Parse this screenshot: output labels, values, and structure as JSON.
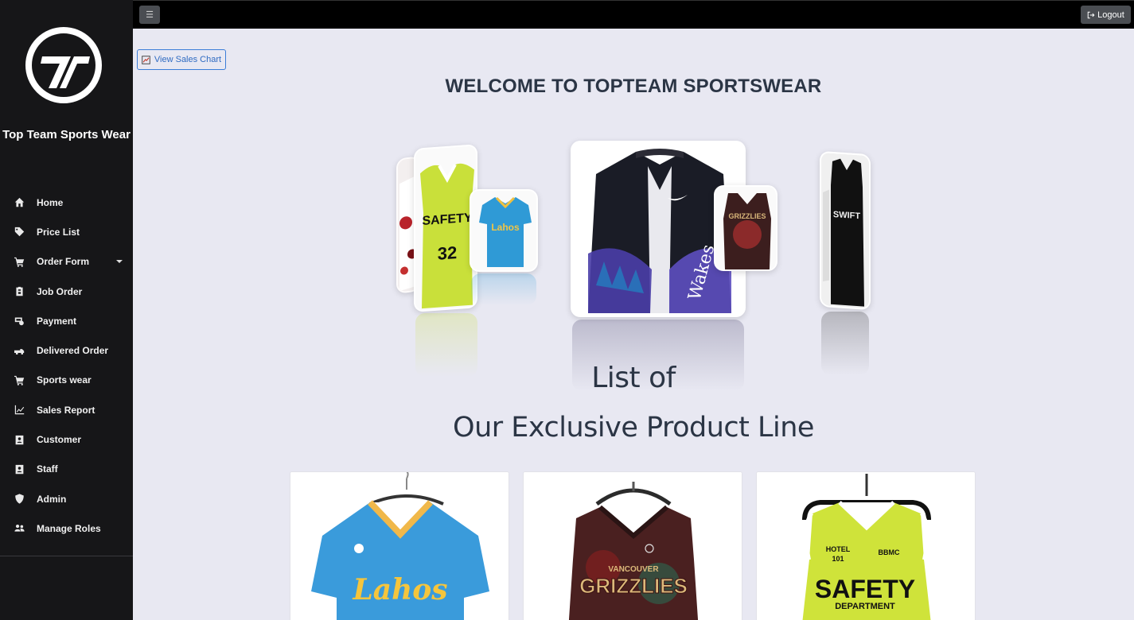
{
  "sidebar": {
    "brand": "Top Team Sports Wear",
    "items": [
      {
        "label": "Home",
        "icon": "home-icon"
      },
      {
        "label": "Price List",
        "icon": "tag-icon"
      },
      {
        "label": "Order Form",
        "icon": "cart-icon",
        "has_dropdown": true
      },
      {
        "label": "Job Order",
        "icon": "clipboard-icon"
      },
      {
        "label": "Payment",
        "icon": "money-icon"
      },
      {
        "label": "Delivered Order",
        "icon": "truck-icon"
      },
      {
        "label": "Sports wear",
        "icon": "cart-icon"
      },
      {
        "label": "Sales Report",
        "icon": "chart-line-icon"
      },
      {
        "label": "Customer",
        "icon": "id-card-icon"
      },
      {
        "label": "Staff",
        "icon": "id-badge-icon"
      },
      {
        "label": "Admin",
        "icon": "shield-icon"
      },
      {
        "label": "Manage Roles",
        "icon": "users-icon"
      }
    ]
  },
  "topbar": {
    "menu_icon": "☰",
    "logout_label": "Logout"
  },
  "main": {
    "sales_chart_label": "View Sales Chart",
    "welcome_title": "WELCOME TO TOPTEAM SPORTSWEAR",
    "list_of": "List of",
    "product_line": "Our Exclusive Product Line"
  },
  "colors": {
    "sidebar_bg": "#161618",
    "topbar_bg": "#000000",
    "content_bg": "#e8e8f2",
    "accent": "#3b7dd8",
    "heading": "#2b3545"
  }
}
